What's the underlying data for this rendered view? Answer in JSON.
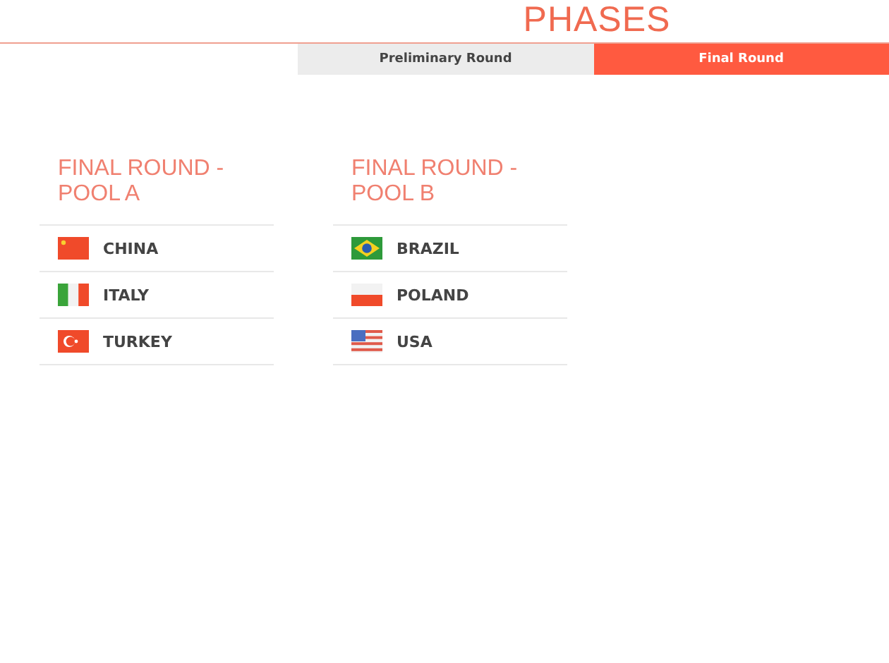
{
  "title": "PHASES",
  "tabs": [
    {
      "label": "Preliminary Round",
      "selected": false
    },
    {
      "label": "Final Round",
      "selected": true
    }
  ],
  "pools": [
    {
      "title": "FINAL ROUND - POOL A",
      "teams": [
        {
          "name": "CHINA",
          "kind": "china"
        },
        {
          "name": "ITALY",
          "kind": "italy"
        },
        {
          "name": "TURKEY",
          "kind": "turkey"
        }
      ]
    },
    {
      "title": "FINAL ROUND - POOL B",
      "teams": [
        {
          "name": "BRAZIL",
          "kind": "brazil"
        },
        {
          "name": "POLAND",
          "kind": "poland"
        },
        {
          "name": "USA",
          "kind": "usa"
        }
      ]
    }
  ]
}
